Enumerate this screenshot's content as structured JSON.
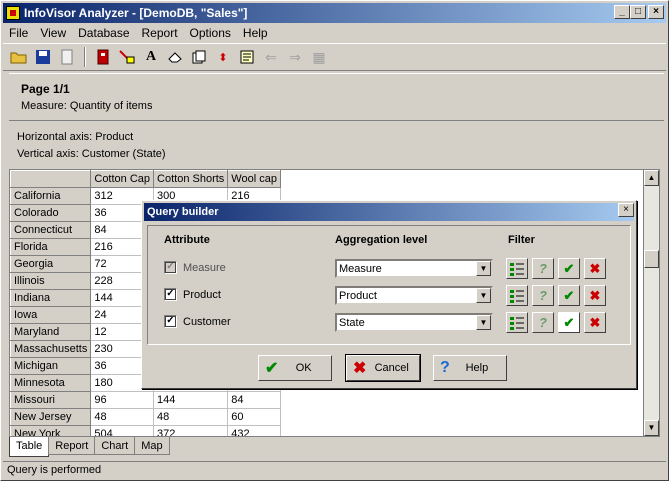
{
  "window": {
    "title": "InfoVisor Analyzer - [DemoDB, \"Sales\"]"
  },
  "menu": [
    "File",
    "View",
    "Database",
    "Report",
    "Options",
    "Help"
  ],
  "toolbar_icons": [
    "open-folder",
    "save-disk",
    "document",
    "database",
    "connection-tree",
    "font-A",
    "eraser",
    "copy-pages",
    "sort-arrows",
    "properties",
    "arrow-back",
    "arrow-forward",
    "calculator"
  ],
  "info": {
    "page": "Page 1/1",
    "measure": "Measure: Quantity of items"
  },
  "axes": {
    "horizontal": "Horizontal axis: Product",
    "vertical": "Vertical axis: Customer (State)"
  },
  "table": {
    "columns": [
      "Cotton Cap",
      "Cotton Shorts",
      "Wool cap"
    ],
    "rows": [
      {
        "name": "California",
        "values": [
          "312",
          "300",
          "216"
        ]
      },
      {
        "name": "Colorado",
        "values": [
          "36",
          "",
          ""
        ]
      },
      {
        "name": "Connecticut",
        "values": [
          "84",
          "",
          ""
        ]
      },
      {
        "name": "Florida",
        "values": [
          "216",
          "",
          ""
        ]
      },
      {
        "name": "Georgia",
        "values": [
          "72",
          "",
          ""
        ]
      },
      {
        "name": "Illinois",
        "values": [
          "228",
          "",
          ""
        ]
      },
      {
        "name": "Indiana",
        "values": [
          "144",
          "",
          ""
        ]
      },
      {
        "name": "Iowa",
        "values": [
          "24",
          "",
          ""
        ]
      },
      {
        "name": "Maryland",
        "values": [
          "12",
          "",
          ""
        ]
      },
      {
        "name": "Massachusetts",
        "values": [
          "230",
          "",
          ""
        ]
      },
      {
        "name": "Michigan",
        "values": [
          "36",
          "",
          ""
        ]
      },
      {
        "name": "Minnesota",
        "values": [
          "180",
          "",
          ""
        ]
      },
      {
        "name": "Missouri",
        "values": [
          "96",
          "144",
          "84"
        ]
      },
      {
        "name": "New Jersey",
        "values": [
          "48",
          "48",
          "60"
        ]
      },
      {
        "name": "New York",
        "values": [
          "504",
          "372",
          "432"
        ]
      }
    ]
  },
  "tabs": [
    "Table",
    "Report",
    "Chart",
    "Map"
  ],
  "status": "Query is performed",
  "dialog": {
    "title": "Query builder",
    "headers": {
      "attribute": "Attribute",
      "aggregation": "Aggregation level",
      "filter": "Filter"
    },
    "rows": [
      {
        "label": "Measure",
        "checked": "✓",
        "agg": "Measure"
      },
      {
        "label": "Product",
        "checked": "✓",
        "agg": "Product"
      },
      {
        "label": "Customer",
        "checked": "✓",
        "agg": "State"
      }
    ],
    "buttons": {
      "ok": "OK",
      "cancel": "Cancel",
      "help": "Help"
    }
  }
}
